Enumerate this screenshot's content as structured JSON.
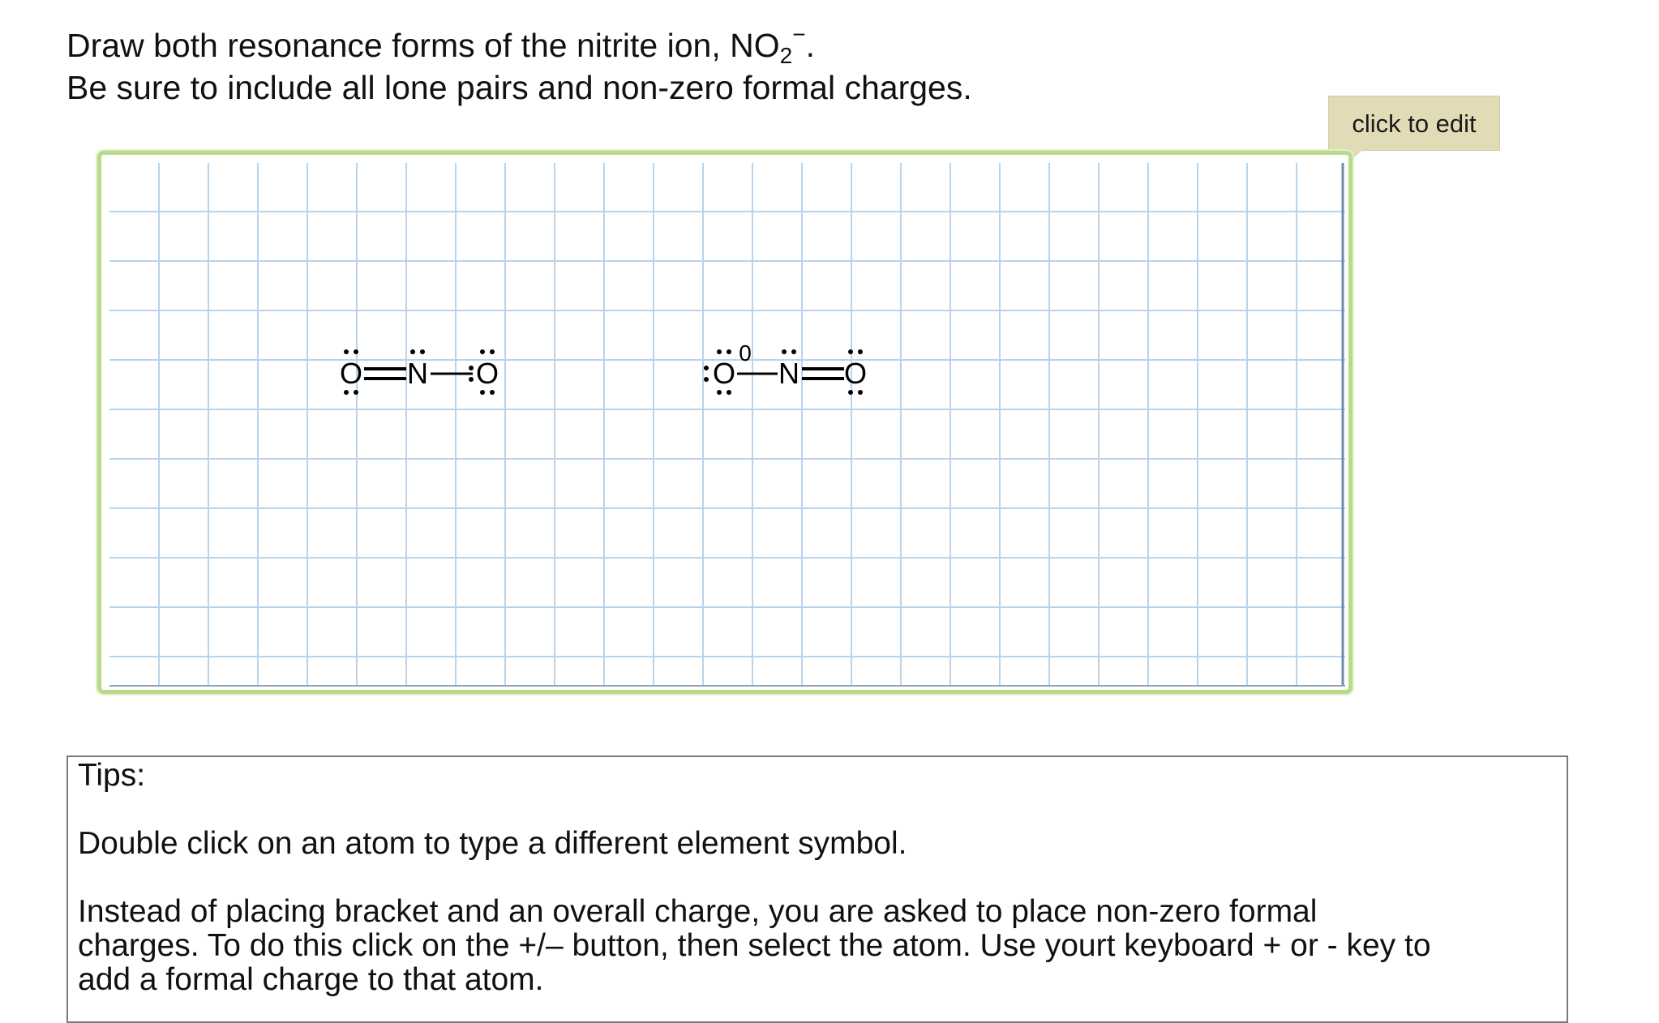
{
  "question": {
    "line1_prefix": "Draw both resonance forms of the nitrite ion, NO",
    "line1_sub": "2",
    "line1_sup": "−",
    "line1_suffix": ".",
    "line2": "Be sure to include all lone pairs and non-zero formal charges."
  },
  "editor": {
    "callout_label": "click to edit"
  },
  "structures": {
    "left": {
      "atoms": [
        "O",
        "N",
        "O"
      ],
      "bonds": [
        "double",
        "single"
      ]
    },
    "right": {
      "atoms": [
        "O",
        "N",
        "O"
      ],
      "bonds": [
        "single",
        "double"
      ],
      "formal_charge_label": "0"
    }
  },
  "tips": {
    "title": "Tips:",
    "tip1": "Double click on an atom to type a different element symbol.",
    "tip2_line1": "Instead of placing bracket and an overall charge, you are asked to place non-zero formal",
    "tip2_line2": "charges. To do this click on the +/–  button, then select the atom. Use yourt keyboard + or - key to",
    "tip2_line3": "add a formal charge to that atom."
  },
  "colors": {
    "frame_border": "#b8da8a",
    "grid_line": "#b9d3ea",
    "callout_bg": "#e2dcb6"
  }
}
